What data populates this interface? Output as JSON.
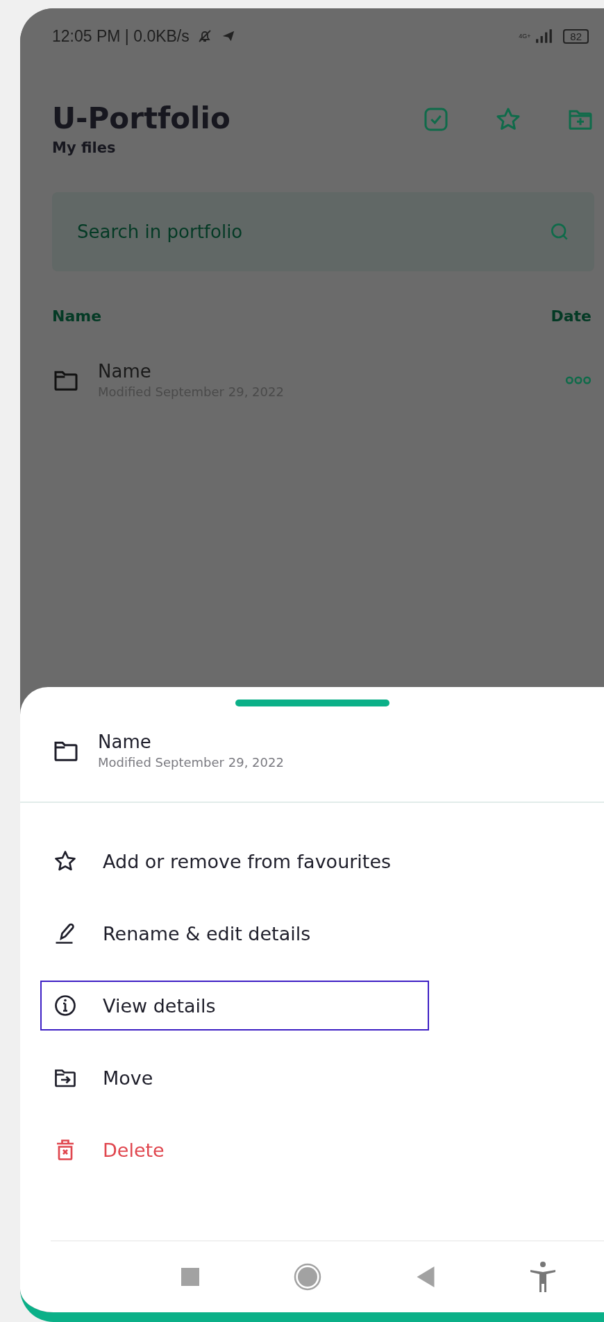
{
  "status_bar": {
    "time": "12:05 PM | 0.0KB/s",
    "network": "4G+",
    "battery": "82"
  },
  "header": {
    "title": "U-Portfolio",
    "subtitle": "My files"
  },
  "search": {
    "placeholder": "Search in portfolio"
  },
  "list_header": {
    "name": "Name",
    "date": "Date"
  },
  "files": [
    {
      "name": "Name",
      "modified": "Modified September 29, 2022"
    }
  ],
  "sheet": {
    "file": {
      "name": "Name",
      "modified": "Modified September 29, 2022"
    },
    "actions": [
      {
        "label": "Add or remove from favourites",
        "kind": "favourite",
        "selected": false
      },
      {
        "label": "Rename & edit details",
        "kind": "rename",
        "selected": false
      },
      {
        "label": "View details",
        "kind": "details",
        "selected": true
      },
      {
        "label": "Move",
        "kind": "move",
        "selected": false
      },
      {
        "label": "Delete",
        "kind": "delete",
        "selected": false
      }
    ]
  }
}
